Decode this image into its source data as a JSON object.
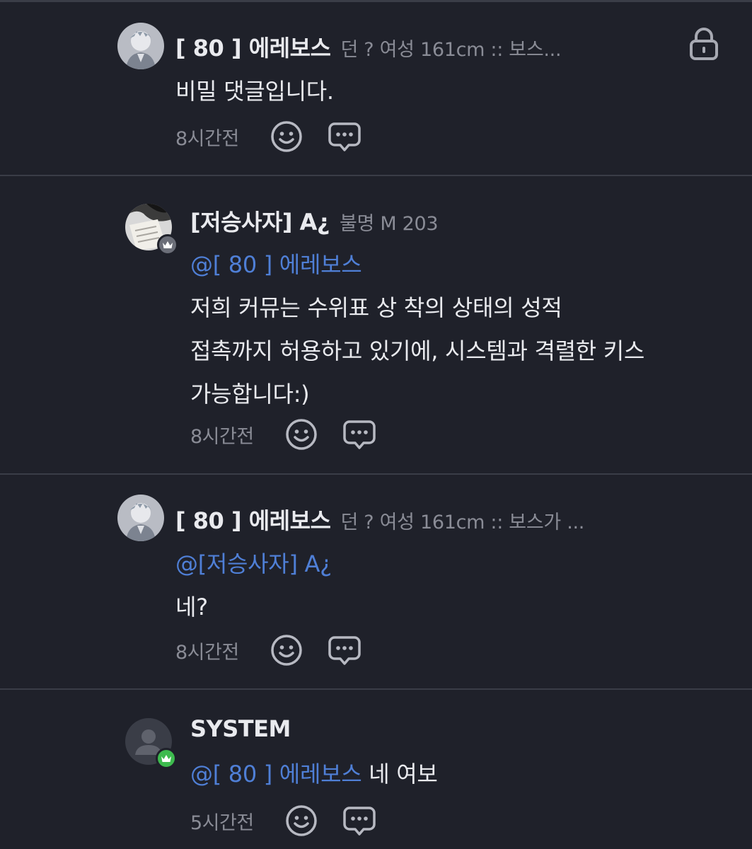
{
  "comments": [
    {
      "author": "[ 80 ] 에레보스",
      "meta": "던 ? 여성 161cm :: 보스...",
      "body": "비밀 댓글입니다.",
      "time": "8시간전"
    },
    {
      "author": "[저승사자] A¿",
      "meta": "불명 M 203",
      "mention": "@[ 80 ] 에레보스",
      "lines": [
        "저희 커뮤는 수위표 상 착의 상태의 성적",
        "접촉까지 허용하고 있기에, 시스템과 격렬한 키스",
        "가능합니다:)"
      ],
      "time": "8시간전"
    },
    {
      "author": "[ 80 ] 에레보스",
      "meta": "던 ? 여성 161cm :: 보스가 ...",
      "mention": "@[저승사자] A¿",
      "body": "네?",
      "time": "8시간전"
    },
    {
      "author": "SYSTEM",
      "mention": "@[ 80 ] 에레보스",
      "body": "네 여보",
      "time": "5시간전"
    }
  ],
  "colors": {
    "background": "#1f212a",
    "mention": "#4f7fd6",
    "divider": "#3a3d47",
    "admin_badge": "#6b6e78",
    "system_badge": "#3dbb4e"
  },
  "icons": {
    "lock": "lock-icon",
    "reaction": "smiley-icon",
    "reply": "speech-bubble-icon",
    "badge": "crown-icon"
  }
}
